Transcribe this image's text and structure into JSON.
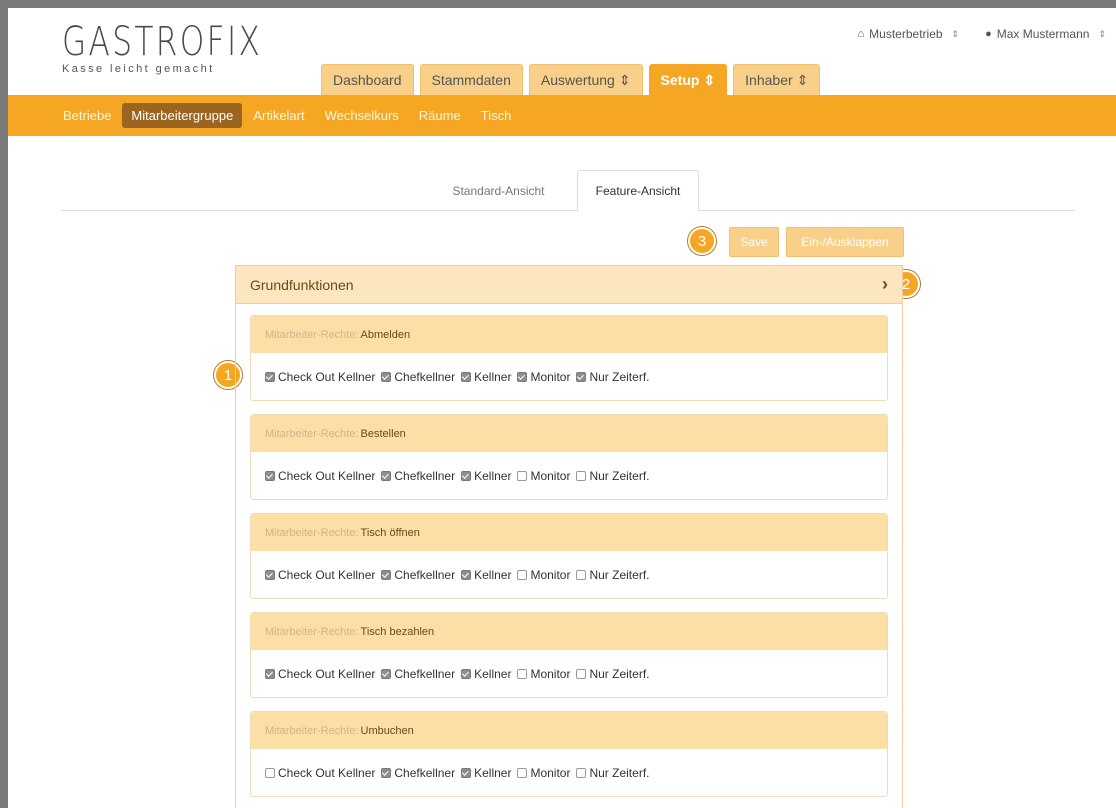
{
  "brand": {
    "name": "GASTROFIX",
    "tagline": "Kasse leicht gemacht"
  },
  "account": {
    "business": "Musterbetrieb",
    "business_icon": "home-icon",
    "user": "Max Mustermann",
    "user_icon": "user-icon"
  },
  "main_tabs": [
    {
      "label": "Dashboard",
      "sorter": ""
    },
    {
      "label": "Stammdaten",
      "sorter": ""
    },
    {
      "label": "Auswertung",
      "sorter": "⇕"
    },
    {
      "label": "Setup",
      "sorter": "⇕"
    },
    {
      "label": "Inhaber",
      "sorter": "⇕"
    }
  ],
  "sub_nav": [
    "Betriebe",
    "Mitarbeitergruppe",
    "Artikelart",
    "Wechselkurs",
    "Räume",
    "Tisch"
  ],
  "view_tabs": {
    "standard": "Standard-Ansicht",
    "feature": "Feature-Ansicht"
  },
  "actions": {
    "save": "Save",
    "toggle": "Ein-/Ausklappen"
  },
  "badges": {
    "b1": "1",
    "b2": "2",
    "b3": "3"
  },
  "panel": {
    "title": "Grundfunktionen",
    "chevron": "›"
  },
  "checkbox_labels": [
    "Check Out Kellner",
    "Chefkellner",
    "Kellner",
    "Monitor",
    "Nur Zeiterf."
  ],
  "cards": [
    {
      "prefix": "Mitarbeiter-Rechte:",
      "title": "Abmelden",
      "checked": [
        true,
        true,
        true,
        true,
        true
      ]
    },
    {
      "prefix": "Mitarbeiter-Rechte:",
      "title": "Bestellen",
      "checked": [
        true,
        true,
        true,
        false,
        false
      ]
    },
    {
      "prefix": "Mitarbeiter-Rechte:",
      "title": "Tisch öffnen",
      "checked": [
        true,
        true,
        true,
        false,
        false
      ]
    },
    {
      "prefix": "Mitarbeiter-Rechte:",
      "title": "Tisch bezahlen",
      "checked": [
        true,
        true,
        true,
        false,
        false
      ]
    },
    {
      "prefix": "Mitarbeiter-Rechte:",
      "title": "Umbuchen",
      "checked": [
        false,
        true,
        true,
        false,
        false
      ]
    }
  ],
  "colors": {
    "accent": "#f5a623",
    "tab_inactive": "#f8d089",
    "subnav_active": "#9b6421",
    "card_head": "#fbdfa6"
  }
}
